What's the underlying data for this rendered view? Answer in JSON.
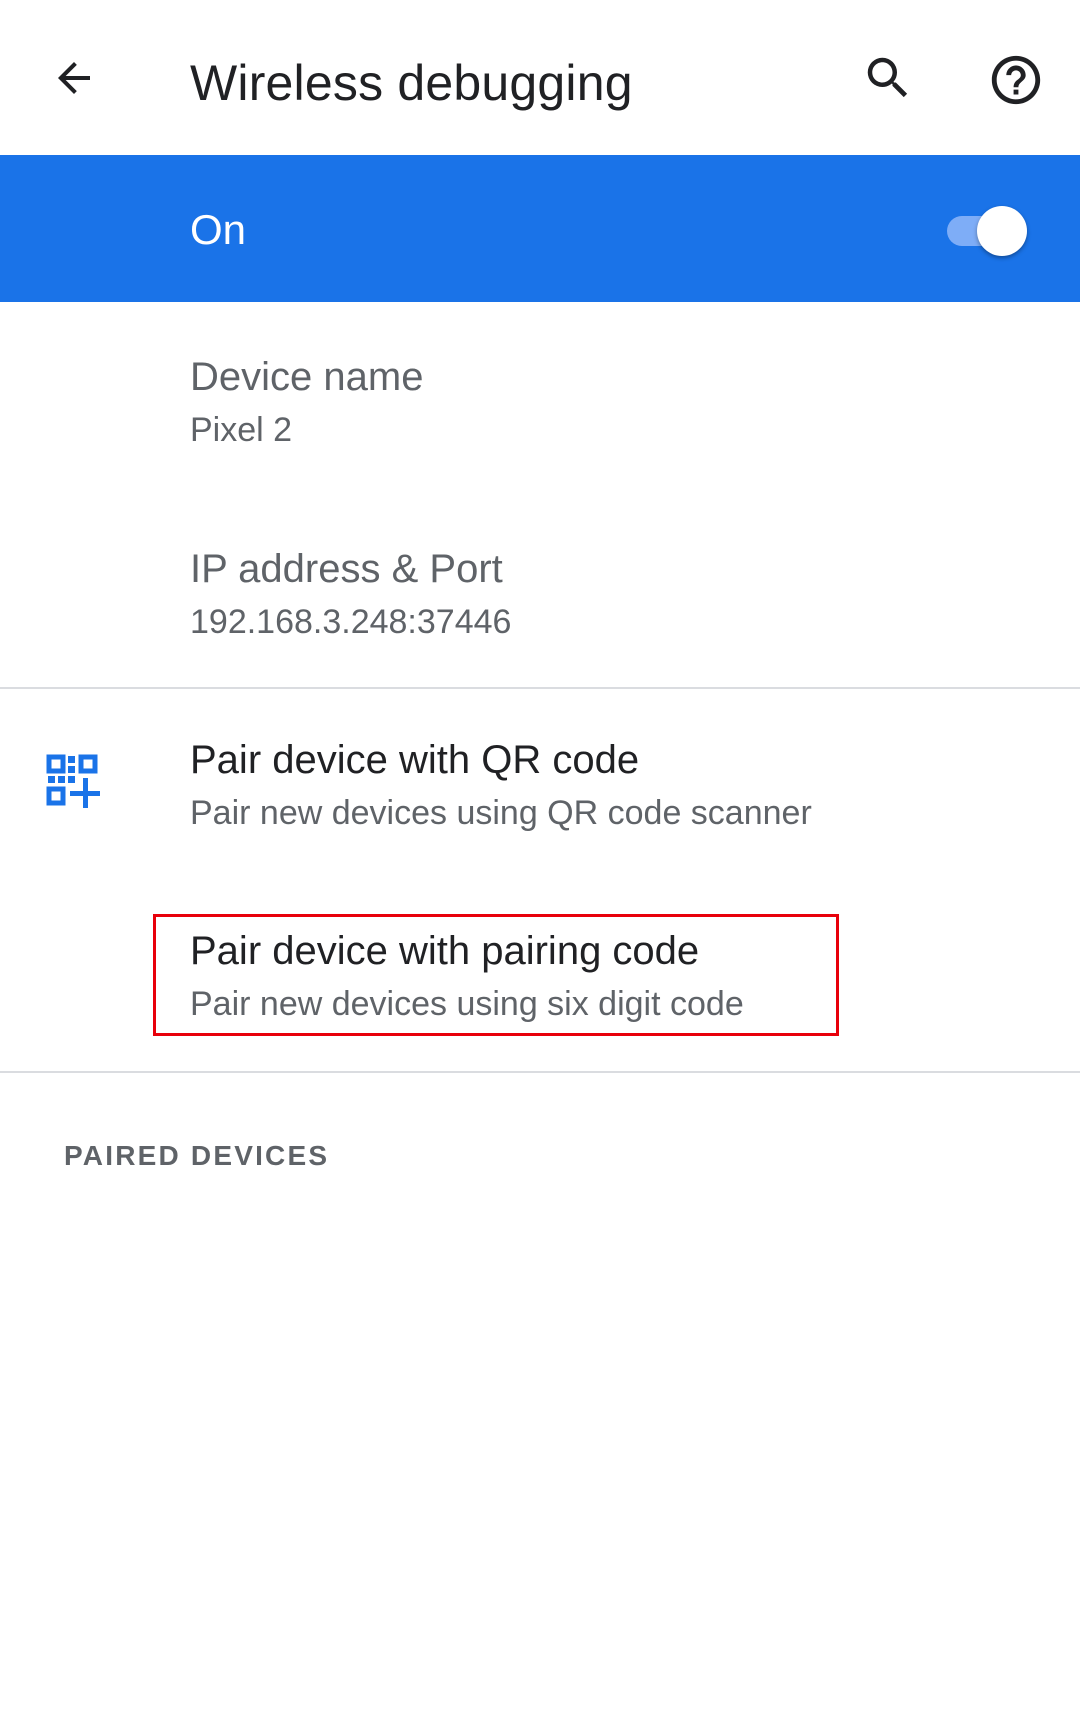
{
  "appbar": {
    "title": "Wireless debugging",
    "back_icon": "arrow-back-icon",
    "search_icon": "search-icon",
    "help_icon": "help-circle-icon"
  },
  "master_switch": {
    "label": "On",
    "checked": true,
    "accent": "#1a73e8"
  },
  "info": {
    "device_name": {
      "title": "Device name",
      "summary": "Pixel 2"
    },
    "ip_address": {
      "title": "IP address & Port",
      "summary": "192.168.3.248:37446"
    }
  },
  "pairing": {
    "qr": {
      "title": "Pair device with QR code",
      "summary": "Pair new devices using QR code scanner",
      "icon": "qr-code-add-icon"
    },
    "code": {
      "title": "Pair device with pairing code",
      "summary": "Pair new devices using six digit code"
    }
  },
  "paired_devices": {
    "header": "PAIRED DEVICES"
  },
  "annotation": {
    "highlight_color": "#e8000b"
  }
}
